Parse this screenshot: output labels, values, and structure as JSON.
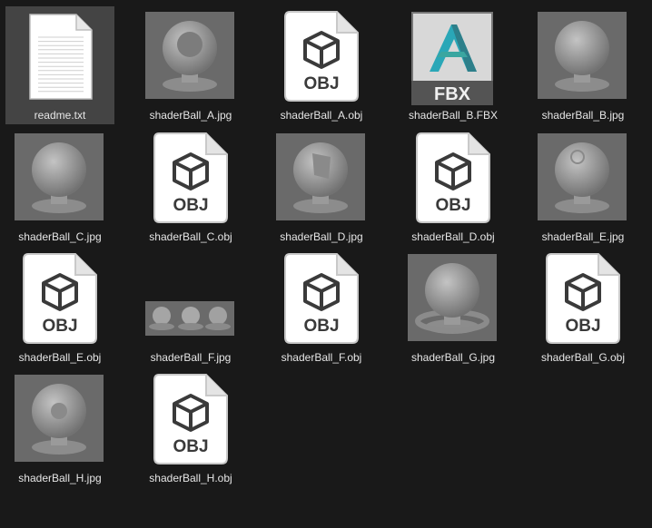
{
  "files": [
    {
      "name": "readme.txt",
      "type": "txt",
      "selected": true
    },
    {
      "name": "shaderBall_A.jpg",
      "type": "jpg",
      "variant": "A"
    },
    {
      "name": "shaderBall_A.obj",
      "type": "obj",
      "badge": "OBJ"
    },
    {
      "name": "shaderBall_B.FBX",
      "type": "fbx",
      "badge": "FBX"
    },
    {
      "name": "shaderBall_B.jpg",
      "type": "jpg",
      "variant": "B"
    },
    {
      "name": "shaderBall_C.jpg",
      "type": "jpg",
      "variant": "C"
    },
    {
      "name": "shaderBall_C.obj",
      "type": "obj",
      "badge": "OBJ"
    },
    {
      "name": "shaderBall_D.jpg",
      "type": "jpg",
      "variant": "D"
    },
    {
      "name": "shaderBall_D.obj",
      "type": "obj",
      "badge": "OBJ"
    },
    {
      "name": "shaderBall_E.jpg",
      "type": "jpg",
      "variant": "E"
    },
    {
      "name": "shaderBall_E.obj",
      "type": "obj",
      "badge": "OBJ"
    },
    {
      "name": "shaderBall_F.jpg",
      "type": "jpg",
      "variant": "F"
    },
    {
      "name": "shaderBall_F.obj",
      "type": "obj",
      "badge": "OBJ"
    },
    {
      "name": "shaderBall_G.jpg",
      "type": "jpg",
      "variant": "G"
    },
    {
      "name": "shaderBall_G.obj",
      "type": "obj",
      "badge": "OBJ"
    },
    {
      "name": "shaderBall_H.jpg",
      "type": "jpg",
      "variant": "H"
    },
    {
      "name": "shaderBall_H.obj",
      "type": "obj",
      "badge": "OBJ"
    }
  ],
  "colors": {
    "background": "#191919",
    "selection": "#444444",
    "label": "#e6e6e6",
    "fbx_accent": "#2aa7b7"
  }
}
